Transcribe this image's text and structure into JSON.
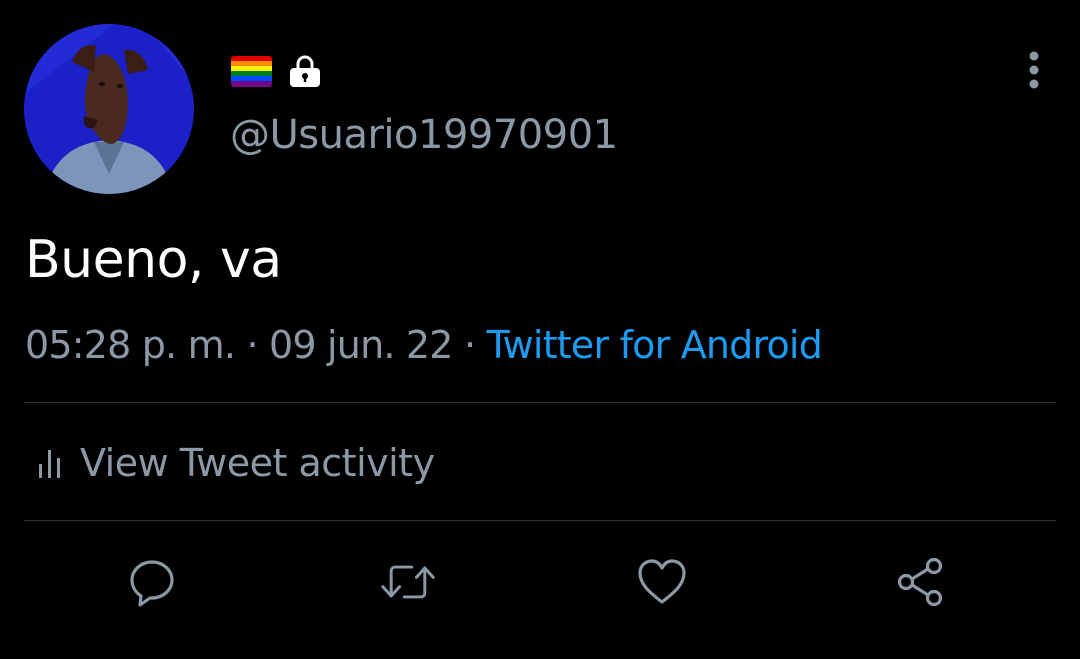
{
  "tweet": {
    "handle": "@Usuario19970901",
    "text": "Bueno, va",
    "time": "05:28 p. m.",
    "separator": "·",
    "date": "09 jun. 22",
    "source": "Twitter for Android",
    "activity_label": "View Tweet activity"
  },
  "badges": {
    "flag_icon": "rainbow-flag-icon",
    "flag_colors": [
      "#e40303",
      "#ff8c00",
      "#ffed00",
      "#008026",
      "#004dff",
      "#750787"
    ],
    "lock_icon": "lock-icon"
  },
  "icons": {
    "more": "more-vertical-icon",
    "activity": "bar-chart-icon",
    "reply": "reply-icon",
    "retweet": "retweet-icon",
    "like": "heart-icon",
    "share": "share-icon"
  },
  "colors": {
    "background": "#000000",
    "primary_text": "#ffffff",
    "secondary_text": "#8b98a5",
    "link": "#1d9bf0",
    "divider": "#2f3336",
    "icon": "#8b98a5"
  }
}
